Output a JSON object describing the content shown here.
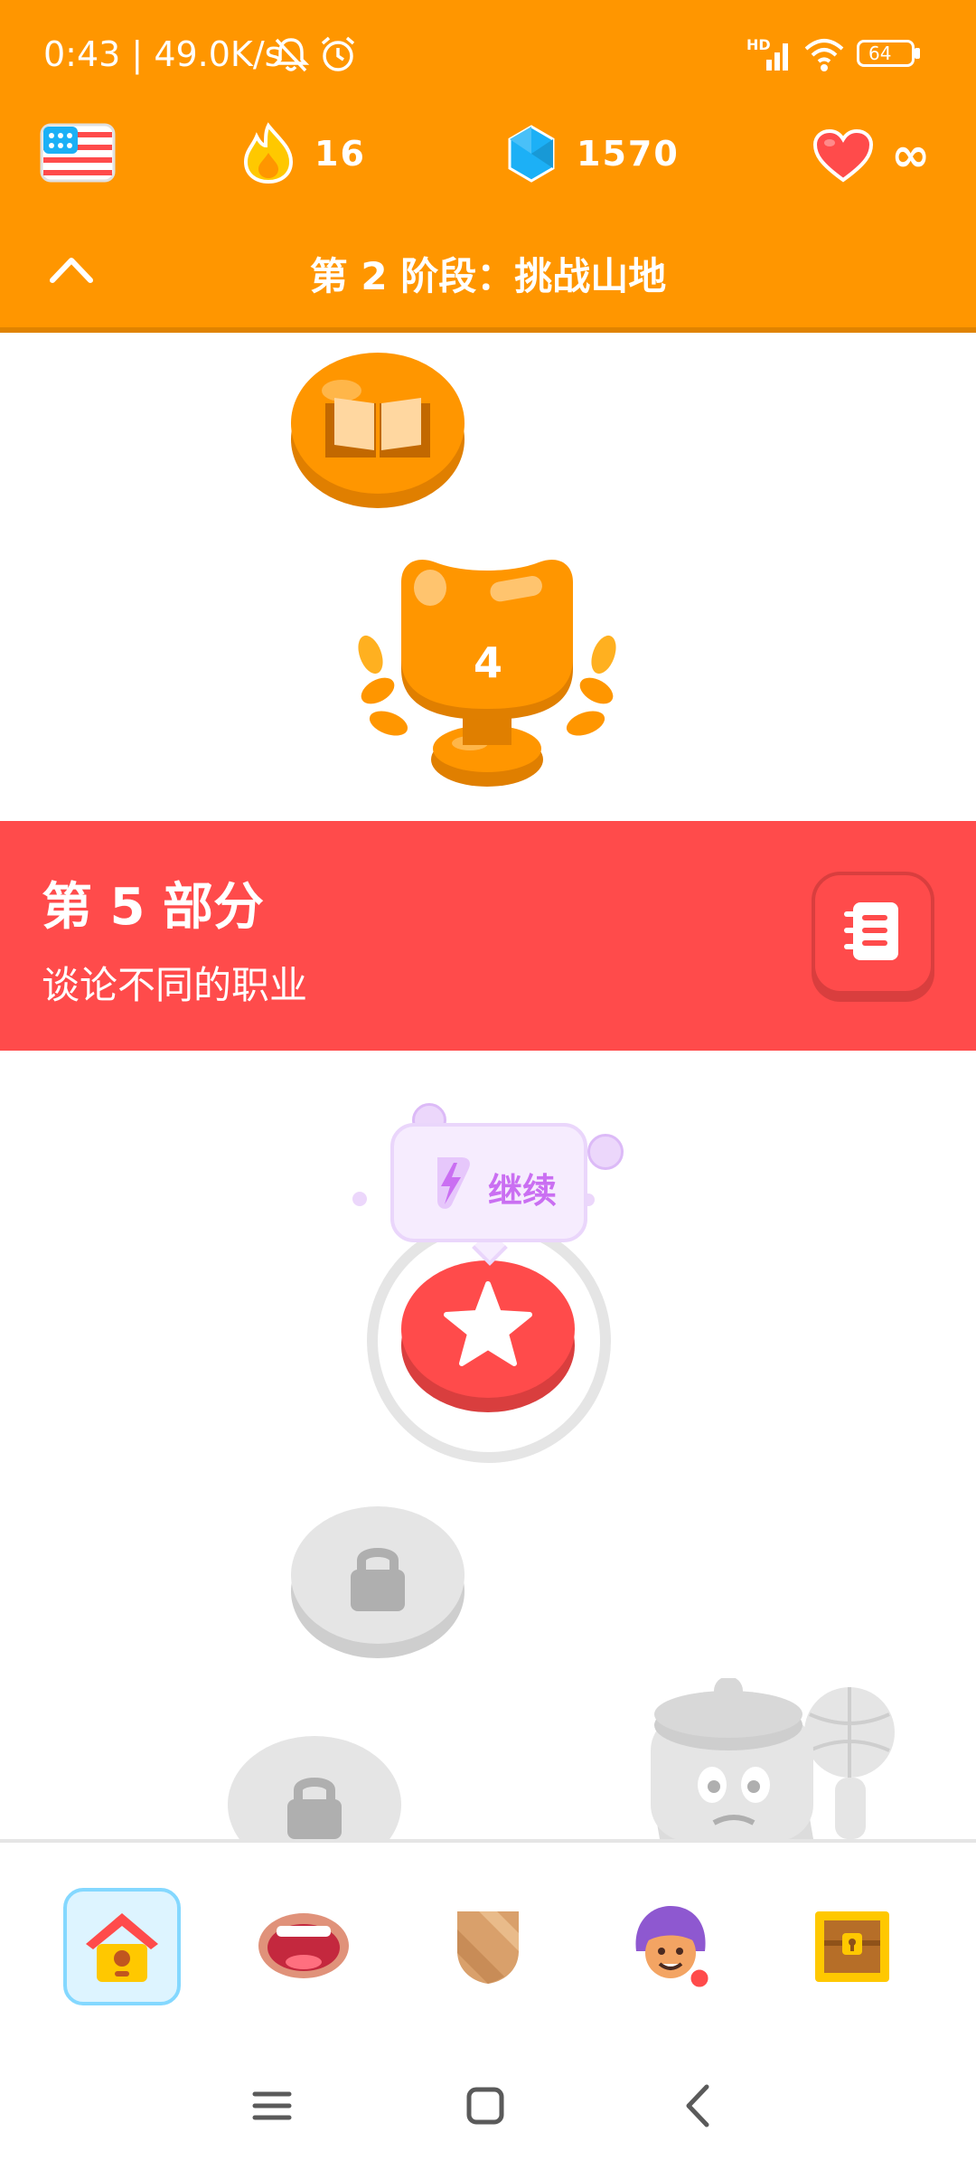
{
  "status_bar": {
    "time": "0:43",
    "net_speed": "49.0K/s",
    "network_badge": "HD",
    "battery": "64",
    "icons": [
      "mute-bell-icon",
      "alarm-icon",
      "signal-icon",
      "wifi-icon",
      "battery-icon"
    ]
  },
  "top_stats": {
    "course_flag": "flag-us-icon",
    "streak": "16",
    "gems": "1570",
    "hearts": "∞"
  },
  "stage_header": {
    "title": "第 2 阶段：挑战山地",
    "collapse_icon": "chevron-up-icon"
  },
  "path_nodes": [
    {
      "type": "story",
      "icon": "book-icon",
      "state": "completed"
    },
    {
      "type": "trophy",
      "label": "4",
      "state": "completed"
    }
  ],
  "unit_banner": {
    "title": "第 5 部分",
    "subtitle": "谈论不同的职业",
    "guide_icon": "guidebook-icon",
    "color": "#ff4b4b"
  },
  "current_lesson": {
    "tooltip_label": "继续",
    "icon": "star-icon",
    "color": "#ff4b4b"
  },
  "locked_nodes": [
    {
      "icon": "lock-icon",
      "state": "locked"
    },
    {
      "icon": "lock-icon",
      "state": "locked"
    }
  ],
  "bottom_nav": [
    {
      "name": "home",
      "icon": "home-icon",
      "active": true
    },
    {
      "name": "speaking",
      "icon": "mouth-icon",
      "active": false
    },
    {
      "name": "leagues",
      "icon": "shield-icon",
      "active": false
    },
    {
      "name": "profile",
      "icon": "avatar-icon",
      "active": false
    },
    {
      "name": "shop",
      "icon": "chest-icon",
      "active": false
    }
  ],
  "colors": {
    "header": "#ff9600",
    "gem": "#1cb0f6",
    "heart": "#ff4b4b",
    "locked": "#e5e5e5"
  }
}
